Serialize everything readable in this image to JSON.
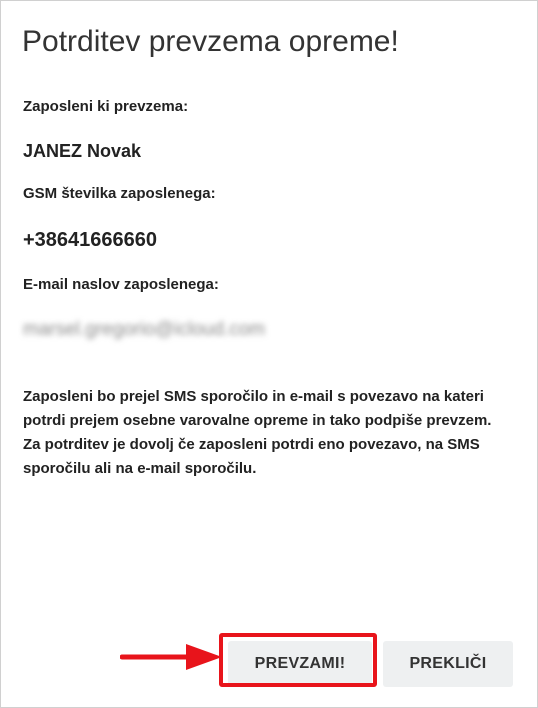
{
  "dialog": {
    "title": "Potrditev prevzema opreme!",
    "employee_label": "Zaposleni ki prevzema:",
    "employee_name": "JANEZ Novak",
    "gsm_label": "GSM številka zaposlenega:",
    "gsm_value": "+38641666660",
    "email_label": "E-mail naslov zaposlenega:",
    "email_value": "marsel.gregorio@icloud.com",
    "info_text": "Zaposleni bo prejel SMS sporočilo in e-mail s povezavo na kateri potrdi prejem osebne varovalne opreme in tako podpiše prevzem. Za potrditev je dovolj če zaposleni potrdi eno povezavo, na SMS sporočilu ali na e-mail sporočilu."
  },
  "buttons": {
    "accept_label": "PREVZAMI!",
    "cancel_label": "PREKLIČI"
  },
  "annotation": {
    "highlight_color": "#e8141b",
    "arrow_icon": "arrow-right-icon"
  }
}
